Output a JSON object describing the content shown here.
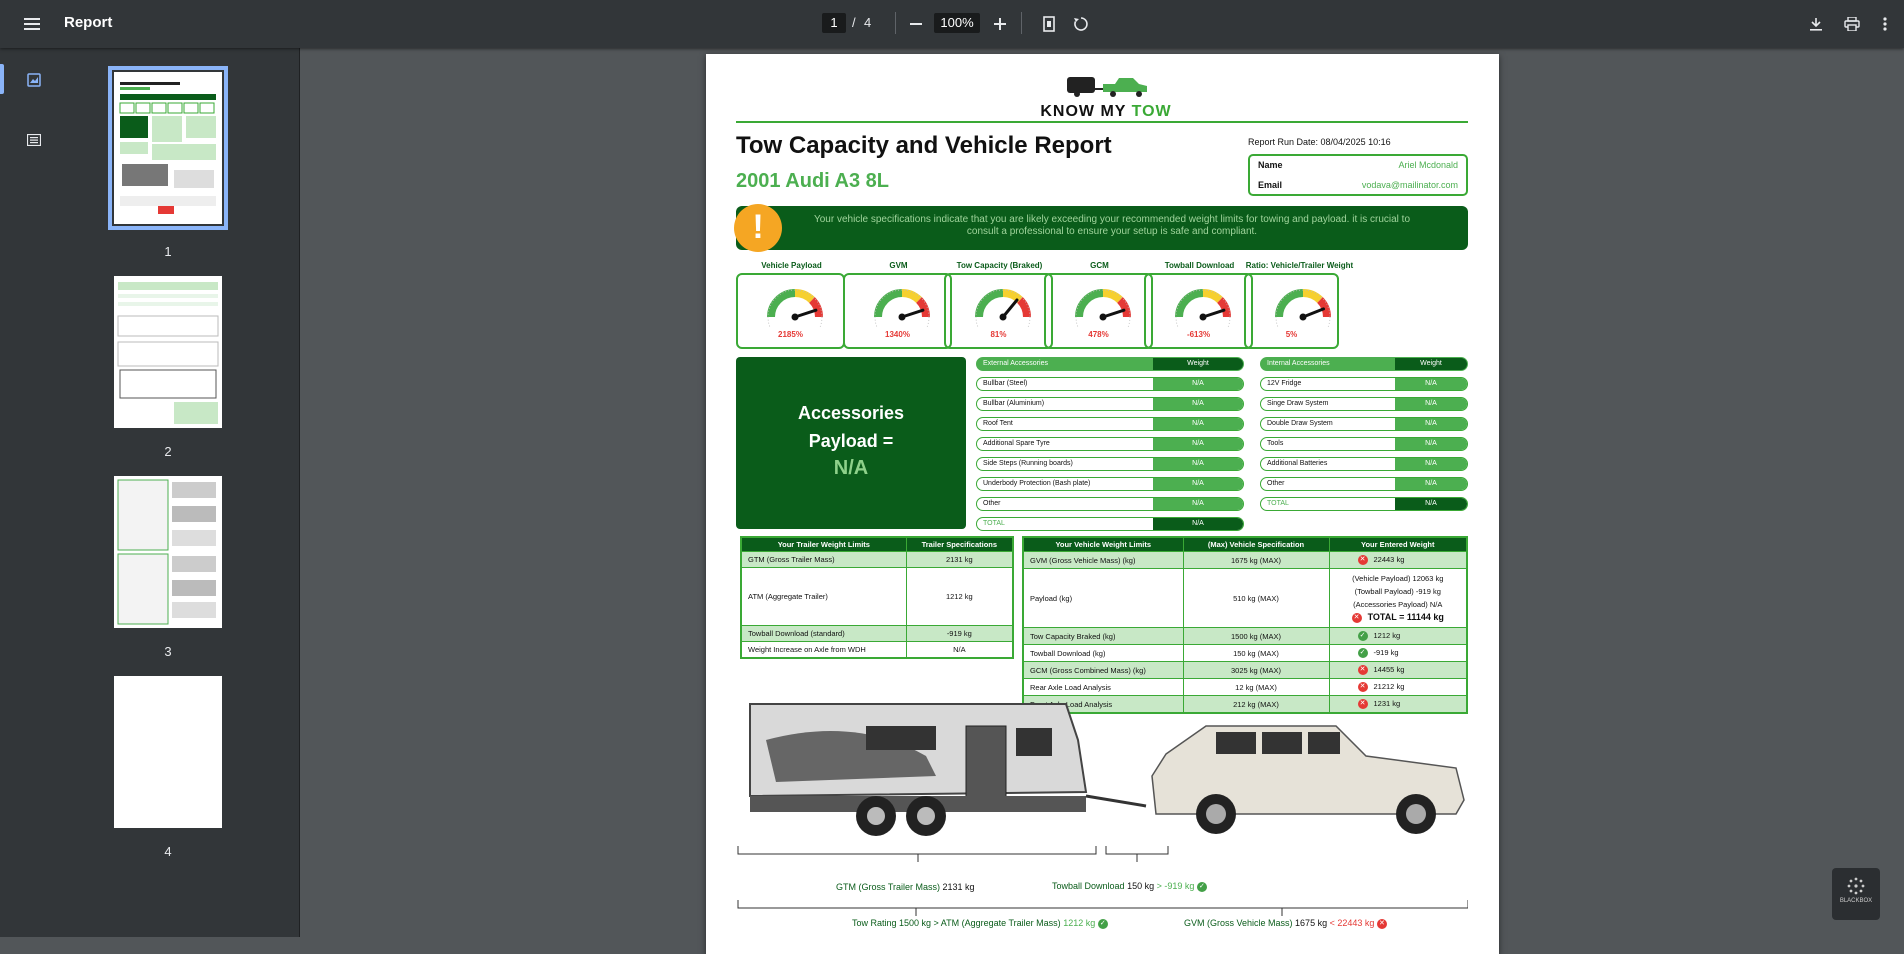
{
  "toolbar": {
    "title": "Report",
    "current_page": "1",
    "page_sep": "/",
    "total_pages": "4",
    "zoom": "100%"
  },
  "sidebar": {
    "thumbnails": [
      {
        "label": "1"
      },
      {
        "label": "2"
      },
      {
        "label": "3"
      },
      {
        "label": "4"
      }
    ]
  },
  "report": {
    "logo": {
      "part1": "KNOW MY ",
      "part2": "TOW"
    },
    "title": "Tow Capacity and Vehicle Report",
    "vehicle": "2001 Audi A3 8L",
    "run_date": "Report Run Date: 08/04/2025 10:16",
    "name_label": "Name",
    "name_value": "Ariel Mcdonald",
    "email_label": "Email",
    "email_value": "vodava@mailinator.com",
    "warning": "Your vehicle specifications indicate that you are likely exceeding your recommended weight limits for towing and payload. it is crucial to consult a professional to ensure your setup is safe and compliant.",
    "gauges": [
      {
        "label": "Vehicle Payload",
        "value": "2185%",
        "fraction": 0.9
      },
      {
        "label": "GVM",
        "value": "1340%",
        "fraction": 0.9
      },
      {
        "label": "Tow Capacity (Braked)",
        "value": "81%",
        "fraction": 0.72
      },
      {
        "label": "GCM",
        "value": "478%",
        "fraction": 0.9
      },
      {
        "label": "Towball Download",
        "value": "-613%",
        "fraction": 0.9
      },
      {
        "label": "Ratio: Vehicle/Trailer Weight",
        "value": "5%",
        "fraction": 0.88
      }
    ],
    "accessories_payload": {
      "title_line1": "Accessories",
      "title_line2": "Payload =",
      "value": "N/A"
    },
    "external": {
      "header": "External Accessories",
      "weight_header": "Weight",
      "rows": [
        {
          "name": "Bullbar (Steel)",
          "weight": "N/A"
        },
        {
          "name": "Bullbar (Aluminium)",
          "weight": "N/A"
        },
        {
          "name": "Roof Tent",
          "weight": "N/A"
        },
        {
          "name": "Additional Spare Tyre",
          "weight": "N/A"
        },
        {
          "name": "Side Steps (Running boards)",
          "weight": "N/A"
        },
        {
          "name": "Underbody Protection (Bash plate)",
          "weight": "N/A"
        },
        {
          "name": "Other",
          "weight": "N/A"
        }
      ],
      "total_label": "TOTAL",
      "total_value": "N/A"
    },
    "internal": {
      "header": "Internal Accessories",
      "weight_header": "Weight",
      "rows": [
        {
          "name": "12V Fridge",
          "weight": "N/A"
        },
        {
          "name": "Singe Draw System",
          "weight": "N/A"
        },
        {
          "name": "Double Draw System",
          "weight": "N/A"
        },
        {
          "name": "Tools",
          "weight": "N/A"
        },
        {
          "name": "Additional Batteries",
          "weight": "N/A"
        },
        {
          "name": "Other",
          "weight": "N/A"
        }
      ],
      "total_label": "TOTAL",
      "total_value": "N/A"
    },
    "trailer_table": {
      "h1": "Your Trailer Weight Limits",
      "h2": "Trailer Specifications",
      "rows": [
        {
          "name": "GTM (Gross Trailer Mass)",
          "value": "2131 kg"
        },
        {
          "name": "ATM (Aggregate Trailer)",
          "value": "1212 kg"
        },
        {
          "name": "Towball Download (standard)",
          "value": "-919 kg"
        },
        {
          "name": "Weight Increase on Axle from WDH",
          "value": "N/A"
        }
      ]
    },
    "vehicle_table": {
      "h1": "Your Vehicle Weight Limits",
      "h2": "(Max) Vehicle Specification",
      "h3": "Your Entered Weight",
      "rows": [
        {
          "name": "GVM (Gross Vehicle Mass) (kg)",
          "spec": "1675 kg (MAX)",
          "entered": "22443 kg",
          "status": "fail"
        },
        {
          "name": "Payload (kg)",
          "spec": "510 kg (MAX)",
          "entered": "",
          "status": "fail",
          "detail1": "(Vehicle Payload) 12063 kg",
          "detail2": "(Towball Payload) -919 kg",
          "detail3": "(Accessories Payload) N/A",
          "total": "TOTAL = 11144 kg"
        },
        {
          "name": "Tow Capacity Braked (kg)",
          "spec": "1500 kg (MAX)",
          "entered": "1212 kg",
          "status": "ok"
        },
        {
          "name": "Towball Download (kg)",
          "spec": "150 kg (MAX)",
          "entered": "-919 kg",
          "status": "ok"
        },
        {
          "name": "GCM (Gross Combined Mass) (kg)",
          "spec": "3025 kg (MAX)",
          "entered": "14455 kg",
          "status": "fail"
        },
        {
          "name": "Rear Axle Load Analysis",
          "spec": "12 kg (MAX)",
          "entered": "21212 kg",
          "status": "fail"
        },
        {
          "name": "Front Axle Load Analysis",
          "spec": "212 kg (MAX)",
          "entered": "1231 kg",
          "status": "fail"
        }
      ]
    },
    "annotations": {
      "gtm_label": "GTM (Gross Trailer Mass)",
      "gtm_value": "2131 kg",
      "towball_label": "Towball Download",
      "towball_value": "150 kg",
      "towball_cmp": "> -919 kg",
      "tow_rating": "Tow Rating 1500 kg > ATM (Aggregate Trailer Mass)",
      "tow_rating_val": "1212 kg",
      "gvm_label": "GVM (Gross Vehicle Mass)",
      "gvm_value": "1675 kg",
      "gvm_cmp": "< 22443 kg"
    }
  },
  "watermark": "BLACKBOX"
}
